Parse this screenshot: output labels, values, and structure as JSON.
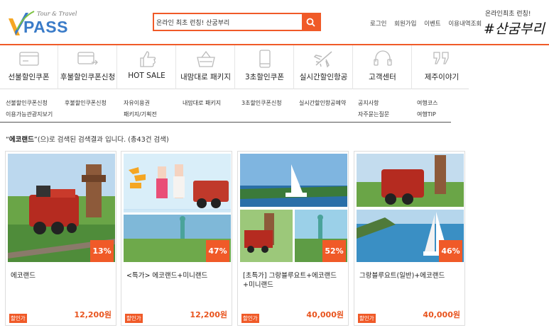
{
  "header": {
    "logo": {
      "tagline": "Tour & Travel",
      "brand_prefix": "V",
      "brand_main": "PASS"
    },
    "search": {
      "value": "온라인 최초 런칭! 산굼부리",
      "button_icon": "search-icon"
    },
    "top_links": [
      "로그인",
      "회원가입",
      "이벤트",
      "이용내역조회"
    ],
    "promo": {
      "line1": "온라인최초 런칭!",
      "line2": "#산굼부리"
    }
  },
  "nav": [
    {
      "label": "선불할인쿠폰",
      "icon": "card-icon"
    },
    {
      "label": "후불할인쿠폰신청",
      "icon": "card-arrow-icon"
    },
    {
      "label": "HOT SALE",
      "icon": "thumbs-up-icon"
    },
    {
      "label": "내맘대로 패키지",
      "icon": "basket-icon"
    },
    {
      "label": "3초할인쿠폰",
      "icon": "phone-icon"
    },
    {
      "label": "실시간할인항공",
      "icon": "airplane-icon"
    },
    {
      "label": "고객센터",
      "icon": "headset-icon"
    },
    {
      "label": "제주이야기",
      "icon": "quote-icon"
    }
  ],
  "submenu": {
    "col1": [
      "선불할인쿠폰신청",
      "이용가능관광지보기"
    ],
    "col2": [
      "후불할인쿠폰신청"
    ],
    "col3": [
      "자유이용권",
      "패키지/기획전"
    ],
    "col4": [
      "내맘대로 패키지"
    ],
    "col5": [
      "3초할인쿠폰신청"
    ],
    "col6": [
      "실시간할인항공예약"
    ],
    "col7": [
      "공지사항",
      "자주묻는질문"
    ],
    "col8": [
      "여행코스",
      "여행TIP"
    ]
  },
  "result": {
    "keyword": "에코랜드",
    "text": "(으)로 검색된 검색결과 입니다. (총43건 검색)"
  },
  "products": [
    {
      "title": "에코랜드",
      "discount": "13%",
      "tag": "할인가",
      "price": "12,200원"
    },
    {
      "title": "<특가> 에코랜드+미니랜드",
      "discount": "47%",
      "tag": "할인가",
      "price": "12,200원"
    },
    {
      "title": "[초특가] 그랑블루요트+에코랜드+미니랜드",
      "discount": "52%",
      "tag": "할인가",
      "price": "40,000원"
    },
    {
      "title": "그랑블루요트(일반)+에코랜드",
      "discount": "46%",
      "tag": "할인가",
      "price": "40,000원"
    }
  ],
  "colors": {
    "accent": "#f05a28",
    "brand_blue": "#3a7bc8",
    "price": "#e8541e"
  }
}
